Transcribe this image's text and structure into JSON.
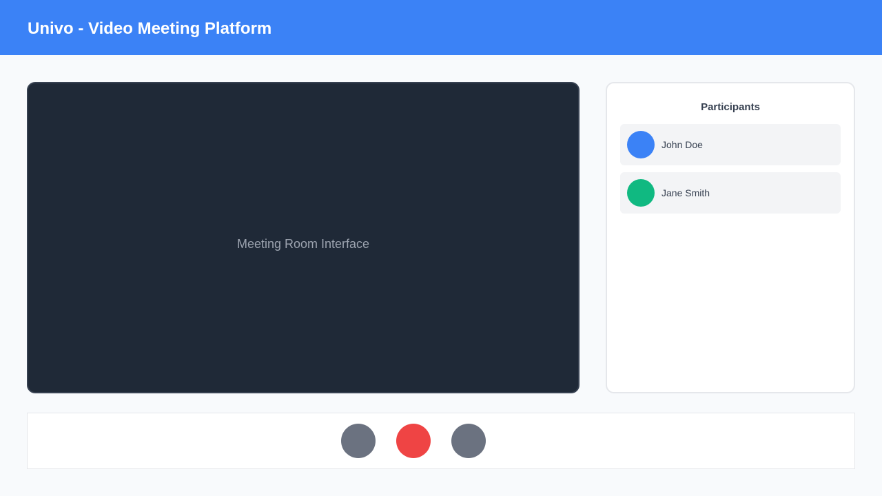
{
  "header": {
    "title": "Univo - Video Meeting Platform",
    "color": "#3b82f6"
  },
  "meeting": {
    "label": "Meeting Room Interface",
    "background": "#1f2937"
  },
  "participants_panel": {
    "title": "Participants",
    "items": [
      {
        "name": "John Doe",
        "avatar_color": "#3b82f6"
      },
      {
        "name": "Jane Smith",
        "avatar_color": "#10b981"
      }
    ]
  },
  "controls": [
    {
      "name": "microphone-button",
      "color": "#6b7280"
    },
    {
      "name": "end-call-button",
      "color": "#ef4444"
    },
    {
      "name": "camera-button",
      "color": "#6b7280"
    }
  ]
}
